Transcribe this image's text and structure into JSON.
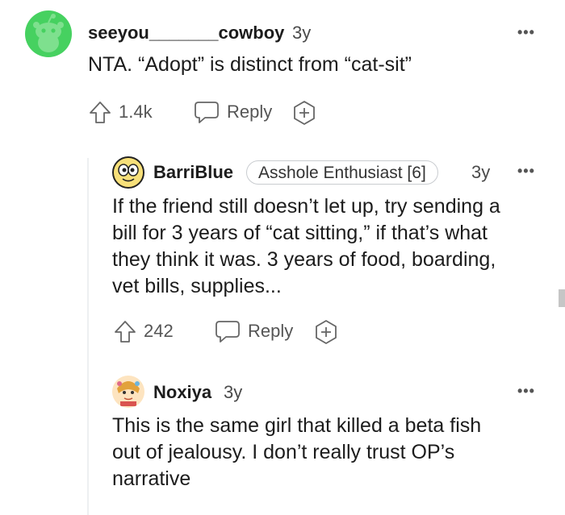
{
  "comments": [
    {
      "username": "seeyou_______cowboy",
      "age": "3y",
      "text": "NTA. “Adopt” is distinct from “cat-sit”",
      "upvotes": "1.4k",
      "reply_label": "Reply"
    },
    {
      "username": "BarriBlue",
      "flair": "Asshole Enthusiast [6]",
      "age": "3y",
      "text_lines": [
        "If the friend still doesn’t let up, try sending a",
        "bill for 3 years of “cat sitting,” if that’s what",
        "they think it was. 3 years of food, boarding,",
        "vet bills, supplies..."
      ],
      "upvotes": "242",
      "reply_label": "Reply"
    },
    {
      "username": "Noxiya",
      "age": "3y",
      "text_lines": [
        "This is the same girl that killed a beta fish",
        "out of jealousy. I don’t really trust OP’s",
        "narrative"
      ]
    }
  ],
  "more_label": "•••",
  "colors": {
    "avatar_green": "#46d160",
    "text": "#1c1c1c",
    "muted": "#555555"
  }
}
